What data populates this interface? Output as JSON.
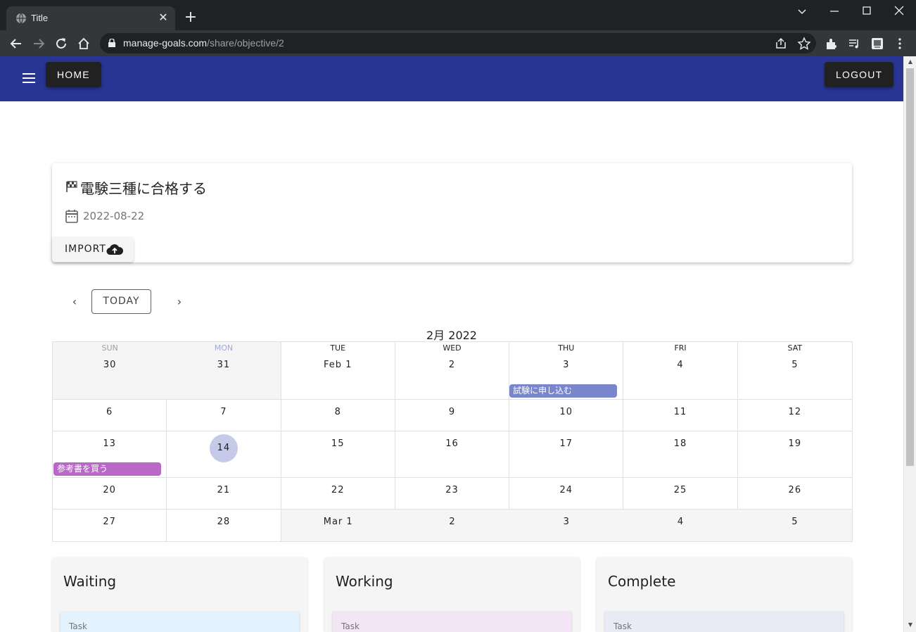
{
  "browser": {
    "tab_title": "Title",
    "url_host": "manage-goals.com",
    "url_path": "/share/objective/2"
  },
  "appbar": {
    "home_label": "HOME",
    "logout_label": "LOGOUT",
    "color": "#283593"
  },
  "goal": {
    "title": "電験三種に合格する",
    "date": "2022-08-22",
    "import_label": "IMPORT"
  },
  "calendar": {
    "today_label": "TODAY",
    "prev_symbol": "‹",
    "next_symbol": "›",
    "month_title": "2月 2022",
    "weekdays": [
      "SUN",
      "MON",
      "TUE",
      "WED",
      "THU",
      "FRI",
      "SAT"
    ],
    "weeks": [
      [
        "30",
        "31",
        "Feb 1",
        "2",
        "3",
        "4",
        "5"
      ],
      [
        "6",
        "7",
        "8",
        "9",
        "10",
        "11",
        "12"
      ],
      [
        "13",
        "14",
        "15",
        "16",
        "17",
        "18",
        "19"
      ],
      [
        "20",
        "21",
        "22",
        "23",
        "24",
        "25",
        "26"
      ],
      [
        "27",
        "28",
        "Mar 1",
        "2",
        "3",
        "4",
        "5"
      ]
    ],
    "events": [
      {
        "label": "試験に申し込む",
        "color": "#7986cb"
      },
      {
        "label": "参考書を買う",
        "color": "#ba68c8"
      }
    ]
  },
  "boards": [
    {
      "title": "Waiting",
      "task_label": "Task",
      "color": "#e3f2fd"
    },
    {
      "title": "Working",
      "task_label": "Task",
      "color": "#f3e5f5"
    },
    {
      "title": "Complete",
      "task_label": "Task",
      "color": "#e8eaf6"
    }
  ]
}
